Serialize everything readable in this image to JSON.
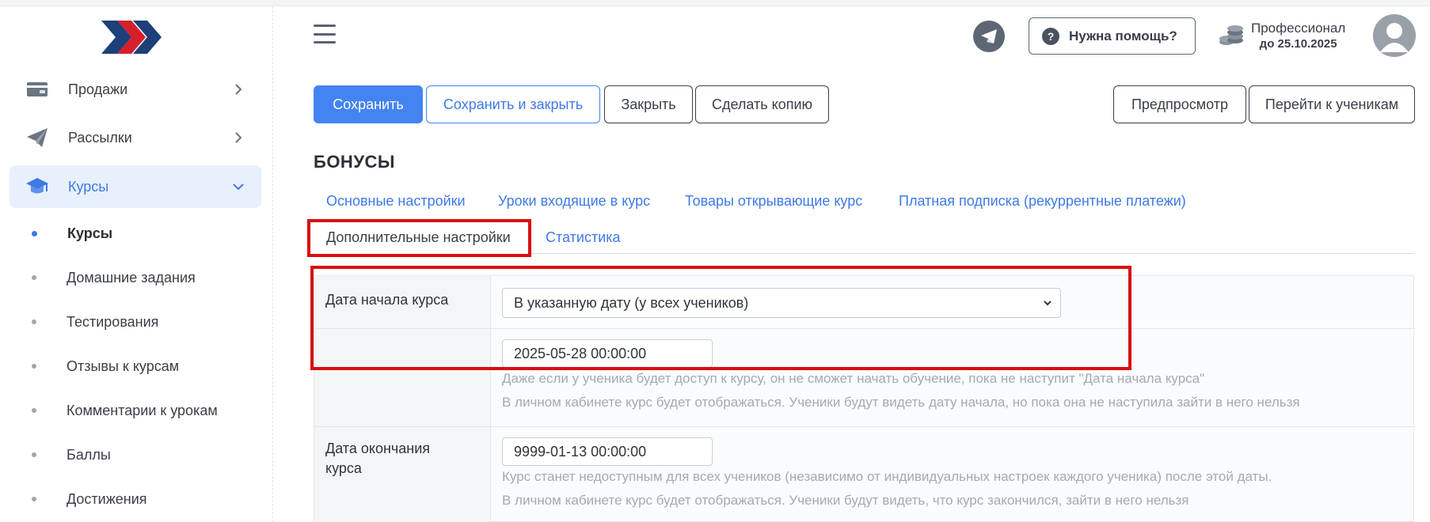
{
  "brand": {
    "accent": "#3d7ae8",
    "highlight": "#d80f0f",
    "logo_icon": "double-chevron-logo"
  },
  "sidebar": {
    "items": [
      {
        "label": "Продажи",
        "icon": "wallet-icon",
        "expanded": false
      },
      {
        "label": "Рассылки",
        "icon": "paper-plane-icon",
        "expanded": false
      },
      {
        "label": "Курсы",
        "icon": "graduation-cap-icon",
        "expanded": true,
        "active": true
      }
    ],
    "subitems": [
      {
        "label": "Курсы",
        "active": true
      },
      {
        "label": "Домашние задания"
      },
      {
        "label": "Тестирования"
      },
      {
        "label": "Отзывы к курсам"
      },
      {
        "label": "Комментарии к урокам"
      },
      {
        "label": "Баллы"
      },
      {
        "label": "Достижения"
      }
    ]
  },
  "header": {
    "help_label": "Нужна помощь?",
    "plan_name": "Профессионал",
    "plan_date": "до 25.10.2025"
  },
  "toolbar": {
    "save": "Сохранить",
    "save_close": "Сохранить и закрыть",
    "close": "Закрыть",
    "copy": "Сделать копию",
    "preview": "Предпросмотр",
    "to_students": "Перейти к ученикам"
  },
  "page": {
    "title": "БОНУСЫ"
  },
  "tabs": [
    "Основные настройки",
    "Уроки входящие в курс",
    "Товары открывающие курс",
    "Платная подписка (рекуррентные платежи)",
    "Дополнительные настройки",
    "Статистика"
  ],
  "form": {
    "start_label": "Дата начала курса",
    "start_mode": "В указанную дату (у всех учеников)",
    "start_date": "2025-05-28 00:00:00",
    "start_hint1": "Даже если у ученика будет доступ к курсу, он не сможет начать обучение, пока не наступит \"Дата начала курса\"",
    "start_hint2": "В личном кабинете курс будет отображаться. Ученики будут видеть дату начала, но пока она не наступила зайти в него нельзя",
    "end_label_1": "Дата окончания",
    "end_label_2": "курса",
    "end_date": "9999-01-13 00:00:00",
    "end_hint1": "Курс станет недоступным для всех учеников (независимо от индивидуальных настроек каждого ученика) после этой даты.",
    "end_hint2": "В личном кабинете курс будет отображаться. Ученики будут видеть, что курс закончился, зайти в него нельзя"
  }
}
